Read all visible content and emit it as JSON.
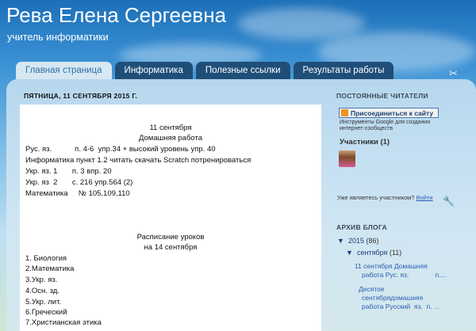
{
  "blog": {
    "title": "Рева Елена Сергеевна",
    "description": "учитель информатики"
  },
  "tabs": [
    {
      "label": "Главная страница",
      "active": true
    },
    {
      "label": "Информатика",
      "active": false
    },
    {
      "label": "Полезные ссылки",
      "active": false
    },
    {
      "label": "Результаты работы",
      "active": false
    }
  ],
  "post": {
    "date_header": "ПЯТНИЦА, 11 СЕНТЯБРЯ 2015 Г.",
    "heading_date": "11 сентября",
    "heading_title": "Домашняя работа",
    "homework": [
      "Рус. яз.           п. 4-6  упр.34 + высокий уровень упр. 40",
      "Информатика пункт 1.2 читать скачать Scratch потренироваться",
      "Укр. яз. 1       п. 3 впр. 20",
      "Укр. яз  2       с. 216 упр.564 (2)",
      "Математика     № 105,109,110"
    ],
    "schedule_title": "Расписание уроков",
    "schedule_date": "на 14 сентября",
    "schedule": [
      "1. Биология",
      "2.Математика",
      "3.Укр. яз.",
      "4.Осн. зд.",
      "5.Укр. лит.",
      "6.Греческий",
      "7.Христианская этика"
    ]
  },
  "sidebar": {
    "followers_heading": "ПОСТОЯННЫЕ ЧИТАТЕЛИ",
    "follow_button": "Присоединиться к сайту",
    "follow_note_1": "Инструменты Google для создания",
    "follow_note_2": "интернет-сообществ",
    "participants_label": "Участники (1)",
    "member_question": "Уже являетесь участником?",
    "login_link": "Войти",
    "archive_heading": "АРХИВ БЛОГА",
    "archive_year": "2015",
    "archive_year_count": "(86)",
    "archive_month": "сентября",
    "archive_month_count": "(11)",
    "archive_posts": [
      {
        "line1": "11 сентября Домашняя",
        "line2": "работа Рус. яз.              п...."
      },
      {
        "line1": "Десятое",
        "line2": "сентябрядомашняя",
        "line3": "работа Русский  яз.  п. ..."
      }
    ]
  },
  "icons": {
    "tools": "scissors-icon",
    "wrench": "wrench-icon",
    "expand": "triangle-down-icon"
  },
  "colors": {
    "tab_bg": "#1f4e78",
    "tab_active_bg": "#d7e8f3",
    "link": "#2a5db0",
    "follow_icon": "#f2921c"
  }
}
